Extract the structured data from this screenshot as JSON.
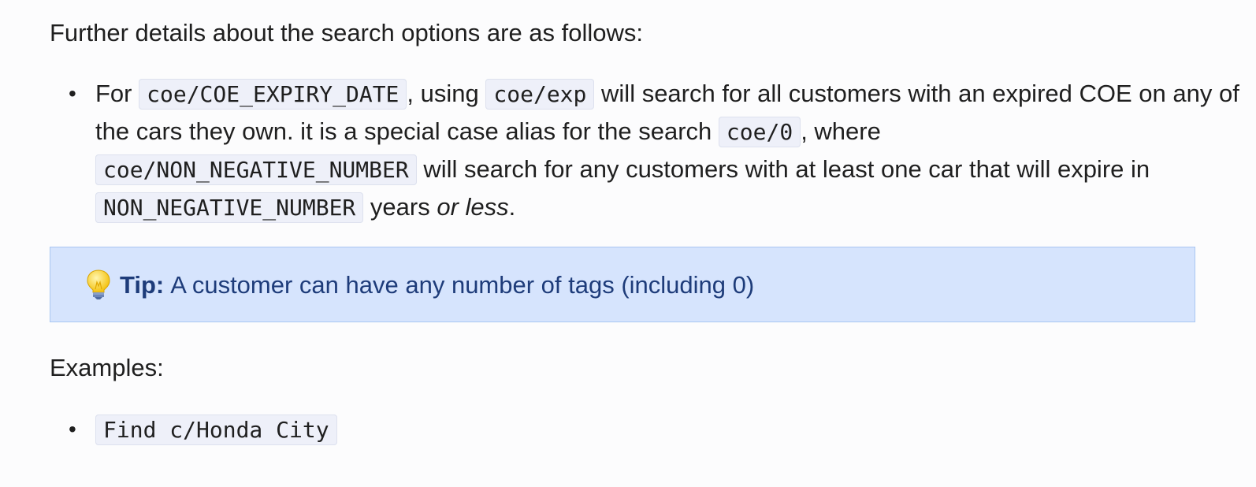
{
  "intro": "Further details about the search options are as follows:",
  "options": {
    "t_for": "For",
    "c_expiry": "coe/COE_EXPIRY_DATE",
    "t_using": ", using",
    "c_exp": "coe/exp",
    "t_will_search": "will search for all customers with an expired COE on any of the cars they own. it is a special case alias for the search",
    "c_zero": "coe/0",
    "t_where": ", where",
    "c_nonneg1": "coe/NON_NEGATIVE_NUMBER",
    "t_any_customers": "will search for any customers with at least one car that will expire in",
    "c_nonneg2": "NON_NEGATIVE_NUMBER",
    "t_years": "years",
    "em_or_less": "or less",
    "t_period": "."
  },
  "tip": {
    "label": "Tip:",
    "text": "A customer can have any number of tags (including 0)"
  },
  "examples": {
    "title": "Examples:",
    "items": [
      "Find c/Honda City"
    ]
  },
  "bullet_char": "•"
}
